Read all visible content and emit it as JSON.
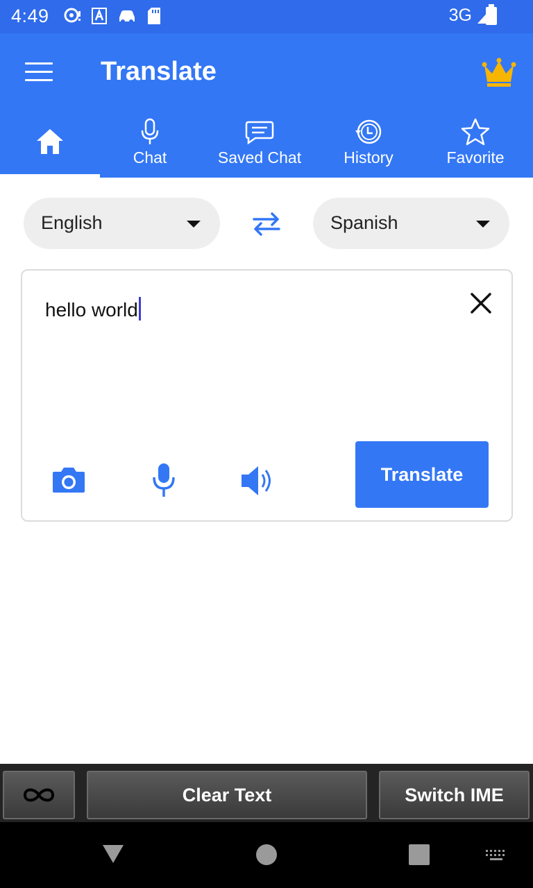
{
  "status_bar": {
    "time": "4:49",
    "network": "3G"
  },
  "app_bar": {
    "title": "Translate"
  },
  "tabs": [
    {
      "id": "home",
      "label": ""
    },
    {
      "id": "chat",
      "label": "Chat"
    },
    {
      "id": "saved",
      "label": "Saved Chat"
    },
    {
      "id": "history",
      "label": "History"
    },
    {
      "id": "favorite",
      "label": "Favorite"
    }
  ],
  "languages": {
    "source": "English",
    "target": "Spanish"
  },
  "input": {
    "text": "hello world"
  },
  "actions": {
    "translate_label": "Translate"
  },
  "keyboard_bar": {
    "clear_label": "Clear Text",
    "switch_label": "Switch IME"
  },
  "colors": {
    "primary": "#3377f5",
    "status_bar": "#2f6bea",
    "accent_crown": "#f7b500"
  }
}
